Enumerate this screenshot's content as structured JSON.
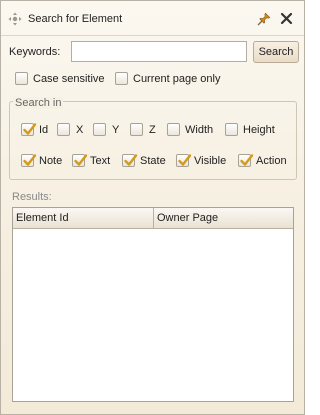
{
  "window": {
    "title": "Search for Element",
    "icons": {
      "move": "move-icon",
      "pin": "pin-icon",
      "close": "close-icon"
    }
  },
  "search": {
    "keywords_label": "Keywords:",
    "keywords_value": "",
    "button_label": "Search",
    "case_sensitive_label": "Case sensitive",
    "current_page_only_label": "Current page only"
  },
  "search_in": {
    "legend": "Search in",
    "options": [
      {
        "label": "Id",
        "checked": true
      },
      {
        "label": "X",
        "checked": false
      },
      {
        "label": "Y",
        "checked": false
      },
      {
        "label": "Z",
        "checked": false
      },
      {
        "label": "Width",
        "checked": false
      },
      {
        "label": "Height",
        "checked": false
      },
      {
        "label": "Note",
        "checked": true
      },
      {
        "label": "Text",
        "checked": true
      },
      {
        "label": "State",
        "checked": true
      },
      {
        "label": "Visible",
        "checked": true
      },
      {
        "label": "Action",
        "checked": true
      }
    ]
  },
  "results": {
    "label": "Results:",
    "columns": [
      "Element Id",
      "Owner Page"
    ],
    "rows": []
  },
  "colors": {
    "checkmark": "#d49a1a",
    "panel_bg": "#f7f1e4"
  }
}
